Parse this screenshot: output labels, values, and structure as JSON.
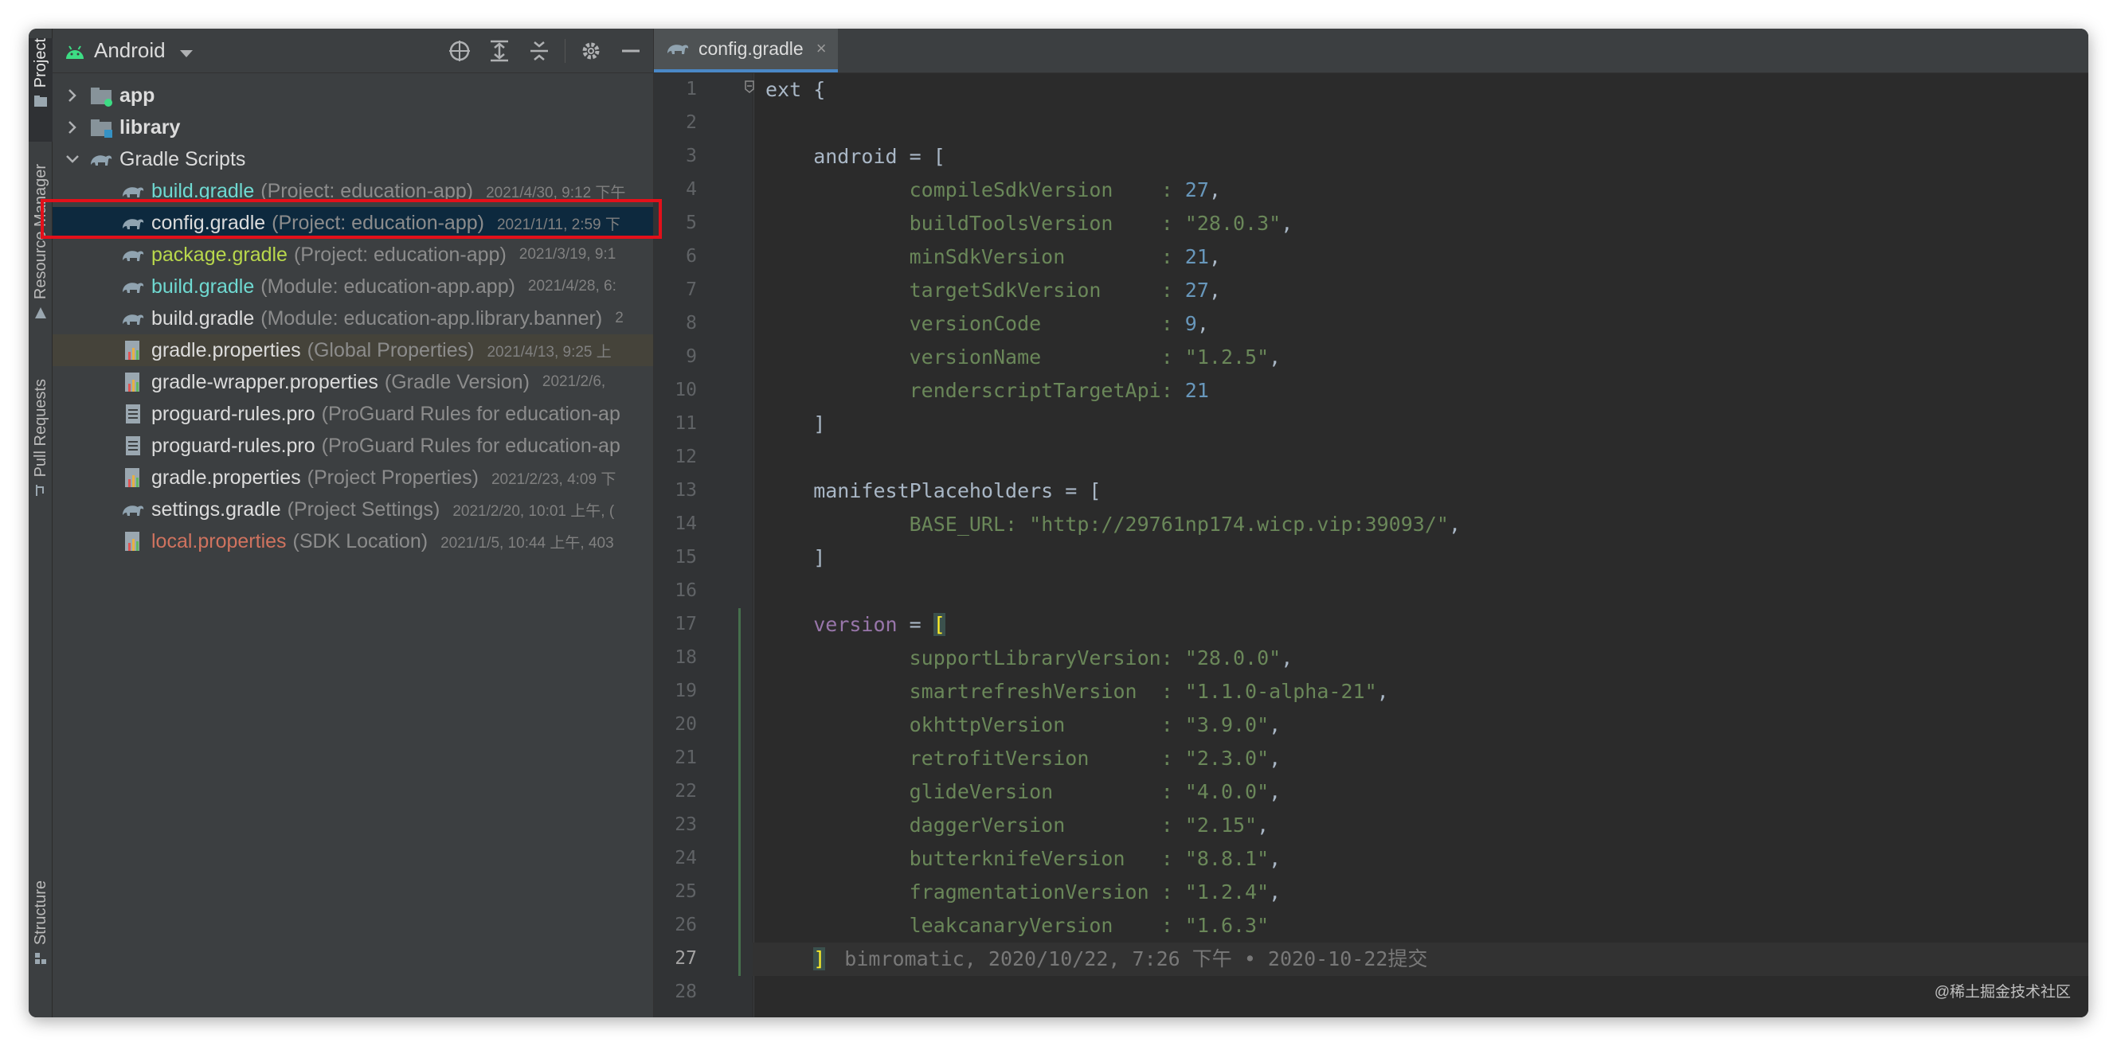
{
  "sidebar_strip": {
    "tabs": [
      {
        "label": "Project",
        "icon": "folder-icon"
      },
      {
        "label": "Resource Manager",
        "icon": "resource-icon"
      },
      {
        "label": "Pull Requests",
        "icon": "pull-request-icon"
      },
      {
        "label": "Structure",
        "icon": "structure-icon"
      }
    ]
  },
  "project_panel": {
    "view_selector": "Android",
    "toolbar_icons": [
      "locate-icon",
      "expand-all-icon",
      "collapse-all-icon",
      "gear-icon",
      "minimize-icon"
    ],
    "tree": [
      {
        "name": "app",
        "hint": "",
        "date": "",
        "indent": 0,
        "chevron": "right",
        "icon": "module-folder-icon",
        "style": "bold"
      },
      {
        "name": "library",
        "hint": "",
        "date": "",
        "indent": 0,
        "chevron": "right",
        "icon": "library-folder-icon",
        "style": "bold"
      },
      {
        "name": "Gradle Scripts",
        "hint": "",
        "date": "",
        "indent": 0,
        "chevron": "down",
        "icon": "gradle-icon",
        "style": "normal"
      },
      {
        "name": "build.gradle",
        "hint": "(Project: education-app)",
        "date": "2021/4/30, 9:12 下午",
        "indent": 1,
        "icon": "gradle-icon",
        "style": "cyan"
      },
      {
        "name": "config.gradle",
        "hint": "(Project: education-app)",
        "date": "2021/1/11, 2:59 下",
        "indent": 1,
        "icon": "gradle-icon",
        "style": "normal",
        "selected": true
      },
      {
        "name": "package.gradle",
        "hint": "(Project: education-app)",
        "date": "2021/3/19, 9:1",
        "indent": 1,
        "icon": "gradle-icon",
        "style": "lime"
      },
      {
        "name": "build.gradle",
        "hint": "(Module: education-app.app)",
        "date": "2021/4/28, 6:",
        "indent": 1,
        "icon": "gradle-icon",
        "style": "cyan"
      },
      {
        "name": "build.gradle",
        "hint": "(Module: education-app.library.banner)",
        "date": "2",
        "indent": 1,
        "icon": "gradle-icon",
        "style": "normal"
      },
      {
        "name": "gradle.properties",
        "hint": "(Global Properties)",
        "date": "2021/4/13, 9:25 上",
        "indent": 1,
        "icon": "properties-icon",
        "style": "normal",
        "highlighted": true
      },
      {
        "name": "gradle-wrapper.properties",
        "hint": "(Gradle Version)",
        "date": "2021/2/6,",
        "indent": 1,
        "icon": "properties-icon",
        "style": "normal"
      },
      {
        "name": "proguard-rules.pro",
        "hint": "(ProGuard Rules for education-ap",
        "date": "",
        "indent": 1,
        "icon": "text-file-icon",
        "style": "normal"
      },
      {
        "name": "proguard-rules.pro",
        "hint": "(ProGuard Rules for education-ap",
        "date": "",
        "indent": 1,
        "icon": "text-file-icon",
        "style": "normal"
      },
      {
        "name": "gradle.properties",
        "hint": "(Project Properties)",
        "date": "2021/2/23, 4:09 下",
        "indent": 1,
        "icon": "properties-icon",
        "style": "normal"
      },
      {
        "name": "settings.gradle",
        "hint": "(Project Settings)",
        "date": "2021/2/20, 10:01 上午, (",
        "indent": 1,
        "icon": "gradle-icon",
        "style": "normal"
      },
      {
        "name": "local.properties",
        "hint": "(SDK Location)",
        "date": "2021/1/5, 10:44 上午, 403",
        "indent": 1,
        "icon": "properties-icon",
        "style": "red"
      }
    ]
  },
  "editor": {
    "tab": {
      "label": "config.gradle",
      "close": "×"
    },
    "current_line": 27,
    "blame": "bimromatic, 2020/10/22, 7:26 下午 • 2020-10-22提交",
    "lines": [
      [
        {
          "t": "ext {",
          "c": "plain"
        }
      ],
      [],
      [
        {
          "t": "    android = [",
          "c": "plain"
        }
      ],
      [
        {
          "t": "            compileSdkVersion    : ",
          "c": "str"
        },
        {
          "t": "27",
          "c": "num"
        },
        {
          "t": ",",
          "c": "plain"
        }
      ],
      [
        {
          "t": "            buildToolsVersion    : ",
          "c": "str"
        },
        {
          "t": "\"28.0.3\"",
          "c": "str"
        },
        {
          "t": ",",
          "c": "plain"
        }
      ],
      [
        {
          "t": "            minSdkVersion        : ",
          "c": "str"
        },
        {
          "t": "21",
          "c": "num"
        },
        {
          "t": ",",
          "c": "plain"
        }
      ],
      [
        {
          "t": "            targetSdkVersion     : ",
          "c": "str"
        },
        {
          "t": "27",
          "c": "num"
        },
        {
          "t": ",",
          "c": "plain"
        }
      ],
      [
        {
          "t": "            versionCode          : ",
          "c": "str"
        },
        {
          "t": "9",
          "c": "num"
        },
        {
          "t": ",",
          "c": "plain"
        }
      ],
      [
        {
          "t": "            versionName          : ",
          "c": "str"
        },
        {
          "t": "\"1.2.5\"",
          "c": "str"
        },
        {
          "t": ",",
          "c": "plain"
        }
      ],
      [
        {
          "t": "            renderscriptTargetApi: ",
          "c": "str"
        },
        {
          "t": "21",
          "c": "num"
        }
      ],
      [
        {
          "t": "    ]",
          "c": "plain"
        }
      ],
      [],
      [
        {
          "t": "    manifestPlaceholders = [",
          "c": "plain"
        }
      ],
      [
        {
          "t": "            BASE_URL: ",
          "c": "str"
        },
        {
          "t": "\"http://29761np174.wicp.vip:39093/\"",
          "c": "str"
        },
        {
          "t": ",",
          "c": "plain"
        }
      ],
      [
        {
          "t": "    ]",
          "c": "plain"
        }
      ],
      [],
      [
        {
          "t": "    ",
          "c": "plain"
        },
        {
          "t": "version",
          "c": "ver"
        },
        {
          "t": " = ",
          "c": "plain"
        },
        {
          "t": "[",
          "c": "bracket"
        }
      ],
      [
        {
          "t": "            supportLibraryVersion: ",
          "c": "str"
        },
        {
          "t": "\"28.0.0\"",
          "c": "str"
        },
        {
          "t": ",",
          "c": "plain"
        }
      ],
      [
        {
          "t": "            smartrefreshVersion  : ",
          "c": "str"
        },
        {
          "t": "\"1.1.0-alpha-21\"",
          "c": "str"
        },
        {
          "t": ",",
          "c": "plain"
        }
      ],
      [
        {
          "t": "            okhttpVersion        : ",
          "c": "str"
        },
        {
          "t": "\"3.9.0\"",
          "c": "str"
        },
        {
          "t": ",",
          "c": "plain"
        }
      ],
      [
        {
          "t": "            retrofitVersion      : ",
          "c": "str"
        },
        {
          "t": "\"2.3.0\"",
          "c": "str"
        },
        {
          "t": ",",
          "c": "plain"
        }
      ],
      [
        {
          "t": "            glideVersion         : ",
          "c": "str"
        },
        {
          "t": "\"4.0.0\"",
          "c": "str"
        },
        {
          "t": ",",
          "c": "plain"
        }
      ],
      [
        {
          "t": "            daggerVersion        : ",
          "c": "str"
        },
        {
          "t": "\"2.15\"",
          "c": "str"
        },
        {
          "t": ",",
          "c": "plain"
        }
      ],
      [
        {
          "t": "            butterknifeVersion   : ",
          "c": "str"
        },
        {
          "t": "\"8.8.1\"",
          "c": "str"
        },
        {
          "t": ",",
          "c": "plain"
        }
      ],
      [
        {
          "t": "            fragmentationVersion : ",
          "c": "str"
        },
        {
          "t": "\"1.2.4\"",
          "c": "str"
        },
        {
          "t": ",",
          "c": "plain"
        }
      ],
      [
        {
          "t": "            leakcanaryVersion    : ",
          "c": "str"
        },
        {
          "t": "\"1.6.3\"",
          "c": "str"
        }
      ],
      [
        {
          "t": "    ",
          "c": "plain"
        },
        {
          "t": "]",
          "c": "bracket"
        }
      ],
      []
    ]
  },
  "watermark": "@稀土掘金技术社区",
  "colors": {
    "window_bg": "#2b2b2b",
    "panel_bg": "#3c3f41",
    "selection": "#0d293e",
    "highlight_red": "#e3101a",
    "string_green": "#6a8759",
    "number_blue": "#6897bb",
    "keyword_purple": "#9876aa"
  }
}
